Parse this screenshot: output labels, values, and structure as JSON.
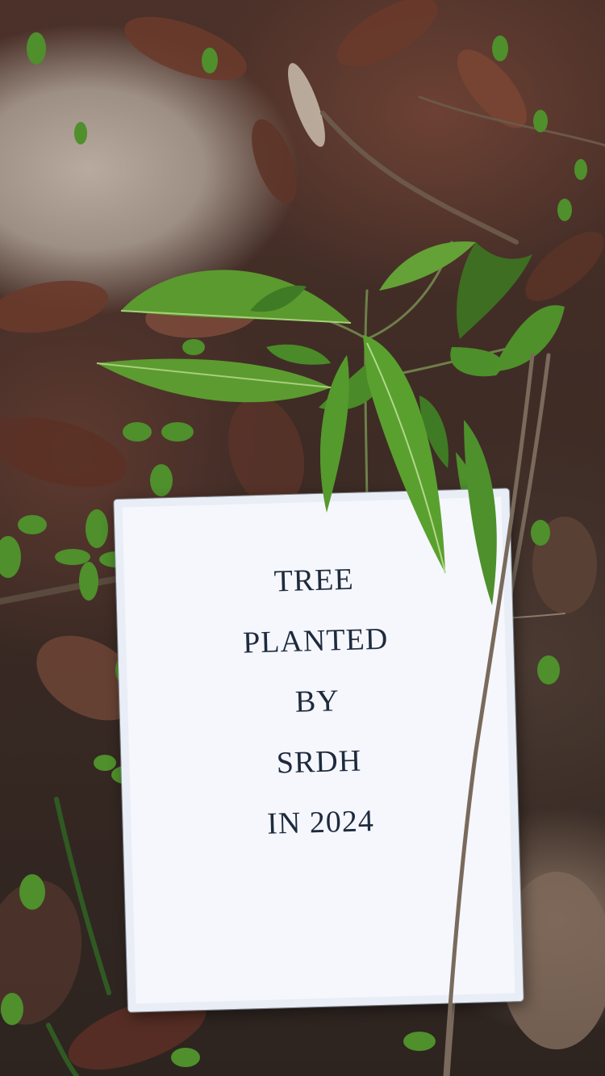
{
  "photo": {
    "subject": "sapling-with-sign"
  },
  "sign": {
    "lines": [
      "TREE",
      "PLANTED",
      "BY",
      "SRDH",
      "IN 2024"
    ]
  },
  "colors": {
    "sign_paper": "#f5f7fc",
    "sign_text": "#1e2a3e",
    "leaf": "#5b9a2e",
    "leaf_dark": "#3d6e22",
    "dry_leaf": "#6a3a2c"
  }
}
